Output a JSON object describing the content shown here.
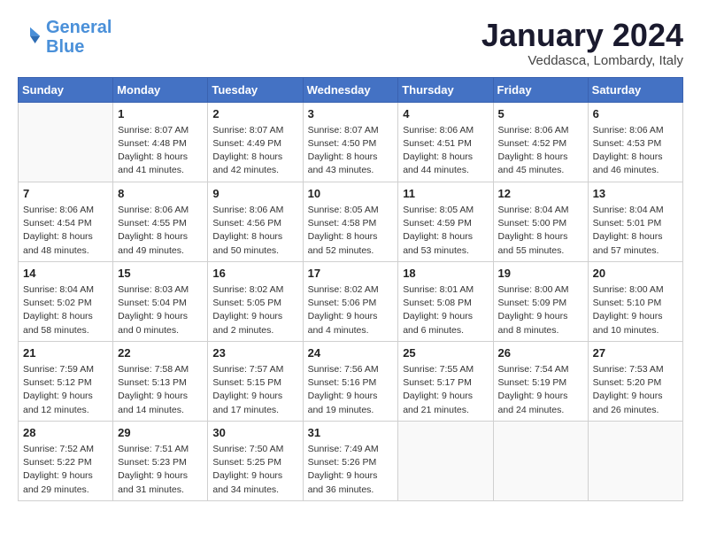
{
  "logo": {
    "line1": "General",
    "line2": "Blue"
  },
  "title": "January 2024",
  "subtitle": "Veddasca, Lombardy, Italy",
  "days_of_week": [
    "Sunday",
    "Monday",
    "Tuesday",
    "Wednesday",
    "Thursday",
    "Friday",
    "Saturday"
  ],
  "weeks": [
    [
      {
        "day": "",
        "info": ""
      },
      {
        "day": "1",
        "info": "Sunrise: 8:07 AM\nSunset: 4:48 PM\nDaylight: 8 hours\nand 41 minutes."
      },
      {
        "day": "2",
        "info": "Sunrise: 8:07 AM\nSunset: 4:49 PM\nDaylight: 8 hours\nand 42 minutes."
      },
      {
        "day": "3",
        "info": "Sunrise: 8:07 AM\nSunset: 4:50 PM\nDaylight: 8 hours\nand 43 minutes."
      },
      {
        "day": "4",
        "info": "Sunrise: 8:06 AM\nSunset: 4:51 PM\nDaylight: 8 hours\nand 44 minutes."
      },
      {
        "day": "5",
        "info": "Sunrise: 8:06 AM\nSunset: 4:52 PM\nDaylight: 8 hours\nand 45 minutes."
      },
      {
        "day": "6",
        "info": "Sunrise: 8:06 AM\nSunset: 4:53 PM\nDaylight: 8 hours\nand 46 minutes."
      }
    ],
    [
      {
        "day": "7",
        "info": "Sunrise: 8:06 AM\nSunset: 4:54 PM\nDaylight: 8 hours\nand 48 minutes."
      },
      {
        "day": "8",
        "info": "Sunrise: 8:06 AM\nSunset: 4:55 PM\nDaylight: 8 hours\nand 49 minutes."
      },
      {
        "day": "9",
        "info": "Sunrise: 8:06 AM\nSunset: 4:56 PM\nDaylight: 8 hours\nand 50 minutes."
      },
      {
        "day": "10",
        "info": "Sunrise: 8:05 AM\nSunset: 4:58 PM\nDaylight: 8 hours\nand 52 minutes."
      },
      {
        "day": "11",
        "info": "Sunrise: 8:05 AM\nSunset: 4:59 PM\nDaylight: 8 hours\nand 53 minutes."
      },
      {
        "day": "12",
        "info": "Sunrise: 8:04 AM\nSunset: 5:00 PM\nDaylight: 8 hours\nand 55 minutes."
      },
      {
        "day": "13",
        "info": "Sunrise: 8:04 AM\nSunset: 5:01 PM\nDaylight: 8 hours\nand 57 minutes."
      }
    ],
    [
      {
        "day": "14",
        "info": "Sunrise: 8:04 AM\nSunset: 5:02 PM\nDaylight: 8 hours\nand 58 minutes."
      },
      {
        "day": "15",
        "info": "Sunrise: 8:03 AM\nSunset: 5:04 PM\nDaylight: 9 hours\nand 0 minutes."
      },
      {
        "day": "16",
        "info": "Sunrise: 8:02 AM\nSunset: 5:05 PM\nDaylight: 9 hours\nand 2 minutes."
      },
      {
        "day": "17",
        "info": "Sunrise: 8:02 AM\nSunset: 5:06 PM\nDaylight: 9 hours\nand 4 minutes."
      },
      {
        "day": "18",
        "info": "Sunrise: 8:01 AM\nSunset: 5:08 PM\nDaylight: 9 hours\nand 6 minutes."
      },
      {
        "day": "19",
        "info": "Sunrise: 8:00 AM\nSunset: 5:09 PM\nDaylight: 9 hours\nand 8 minutes."
      },
      {
        "day": "20",
        "info": "Sunrise: 8:00 AM\nSunset: 5:10 PM\nDaylight: 9 hours\nand 10 minutes."
      }
    ],
    [
      {
        "day": "21",
        "info": "Sunrise: 7:59 AM\nSunset: 5:12 PM\nDaylight: 9 hours\nand 12 minutes."
      },
      {
        "day": "22",
        "info": "Sunrise: 7:58 AM\nSunset: 5:13 PM\nDaylight: 9 hours\nand 14 minutes."
      },
      {
        "day": "23",
        "info": "Sunrise: 7:57 AM\nSunset: 5:15 PM\nDaylight: 9 hours\nand 17 minutes."
      },
      {
        "day": "24",
        "info": "Sunrise: 7:56 AM\nSunset: 5:16 PM\nDaylight: 9 hours\nand 19 minutes."
      },
      {
        "day": "25",
        "info": "Sunrise: 7:55 AM\nSunset: 5:17 PM\nDaylight: 9 hours\nand 21 minutes."
      },
      {
        "day": "26",
        "info": "Sunrise: 7:54 AM\nSunset: 5:19 PM\nDaylight: 9 hours\nand 24 minutes."
      },
      {
        "day": "27",
        "info": "Sunrise: 7:53 AM\nSunset: 5:20 PM\nDaylight: 9 hours\nand 26 minutes."
      }
    ],
    [
      {
        "day": "28",
        "info": "Sunrise: 7:52 AM\nSunset: 5:22 PM\nDaylight: 9 hours\nand 29 minutes."
      },
      {
        "day": "29",
        "info": "Sunrise: 7:51 AM\nSunset: 5:23 PM\nDaylight: 9 hours\nand 31 minutes."
      },
      {
        "day": "30",
        "info": "Sunrise: 7:50 AM\nSunset: 5:25 PM\nDaylight: 9 hours\nand 34 minutes."
      },
      {
        "day": "31",
        "info": "Sunrise: 7:49 AM\nSunset: 5:26 PM\nDaylight: 9 hours\nand 36 minutes."
      },
      {
        "day": "",
        "info": ""
      },
      {
        "day": "",
        "info": ""
      },
      {
        "day": "",
        "info": ""
      }
    ]
  ]
}
